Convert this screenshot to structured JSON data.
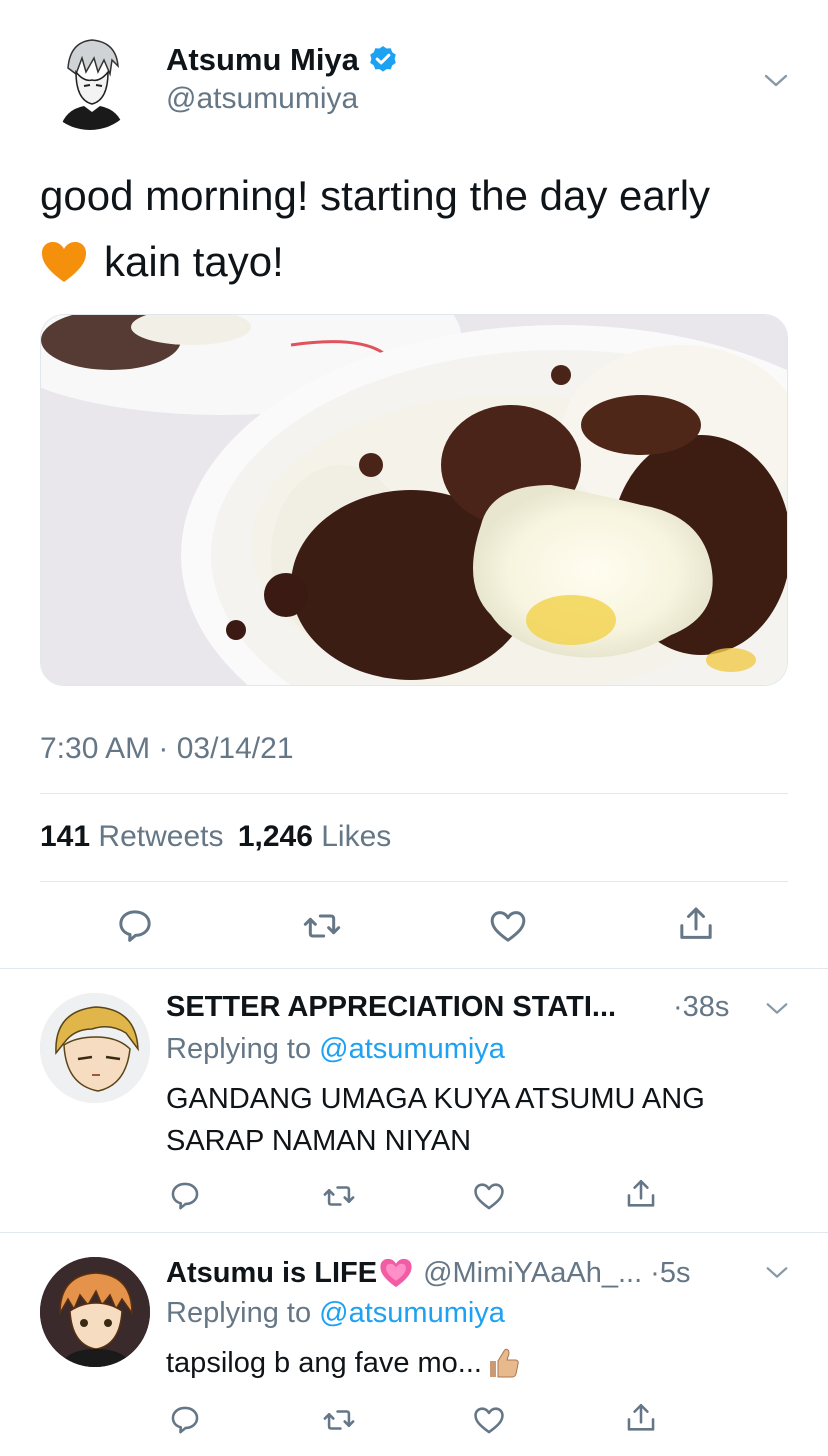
{
  "tweet": {
    "display_name": "Atsumu Miya",
    "handle": "@atsumumiya",
    "verified": true,
    "text_line1": "good morning! starting the day early",
    "text_line2_emoji": "orange-heart",
    "text_line2": "kain tayo!",
    "image_desc": "tapsilog-photo",
    "timestamp": "7:30 AM · 03/14/21",
    "retweets_count": "141",
    "retweets_label": "Retweets",
    "likes_count": "1,246",
    "likes_label": "Likes"
  },
  "replies": [
    {
      "display_name": "SETTER APPRECIATION STATI...",
      "time": "·38s",
      "replying_to_prefix": "Replying to",
      "replying_to_handle": "@atsumumiya",
      "text_line1": "GANDANG UMAGA KUYA ATSUMU ANG",
      "text_line2": "SARAP NAMAN NIYAN"
    },
    {
      "display_name": "Atsumu is LIFE",
      "name_emoji": "growing-heart",
      "handle": "@MimiYAaAh_...",
      "time": "·5s",
      "replying_to_prefix": "Replying to",
      "replying_to_handle": "@atsumumiya",
      "text_line1": "tapsilog b ang fave mo...",
      "text_emoji": "thumbs-up"
    }
  ],
  "colors": {
    "accent": "#1da1f2",
    "secondary_text": "#657786",
    "divider": "#e1e8ed",
    "icon": "#657786"
  }
}
